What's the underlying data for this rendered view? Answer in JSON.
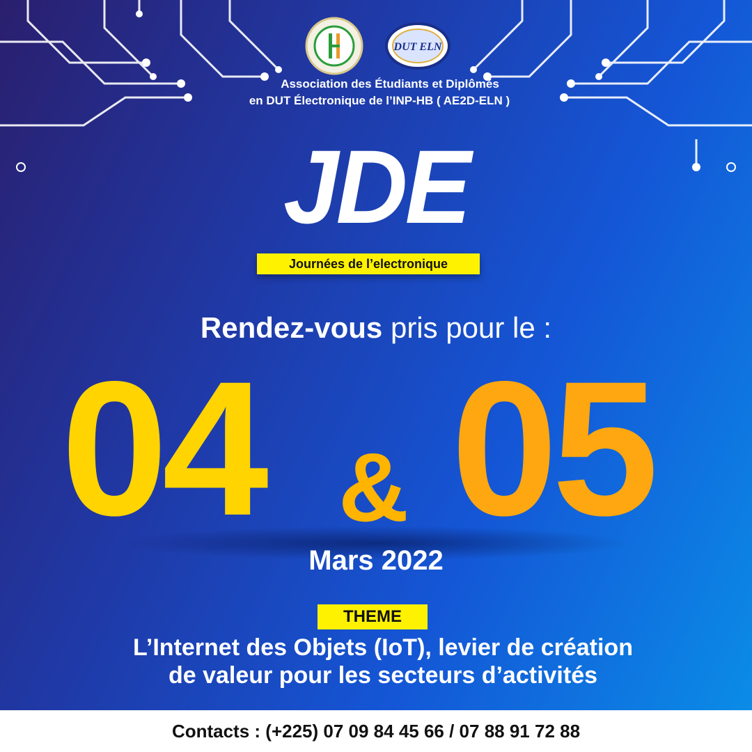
{
  "association": {
    "line1": "Association des Étudiants et Diplômés",
    "line2": "en DUT Électronique de l’INP-HB ( AE2D-ELN )"
  },
  "logos": {
    "left": {
      "icon": "association-seal-logo",
      "color": "#2a9d3a"
    },
    "right": {
      "icon": "dut-eln-logo",
      "text": "DUT ELN"
    }
  },
  "event": {
    "acronym": "JDE",
    "subtitle": "Journées de l’electronique"
  },
  "rendezvous": {
    "bold": "Rendez-vous",
    "rest": " pris pour le :"
  },
  "dates": {
    "day1": "04",
    "separator": "&",
    "day2": "05",
    "month": "Mars 2022"
  },
  "theme": {
    "label": "THEME",
    "line1": "L’Internet des Objets (IoT), levier de création",
    "line2": "de valeur pour les secteurs d’activités"
  },
  "contacts": "Contacts : (+225) 07 09 84 45 66 / 07 88 91 72 88",
  "colors": {
    "accent_yellow": "#fff200",
    "date_gold": "#ffc400",
    "background_blue": "#1456d6"
  }
}
